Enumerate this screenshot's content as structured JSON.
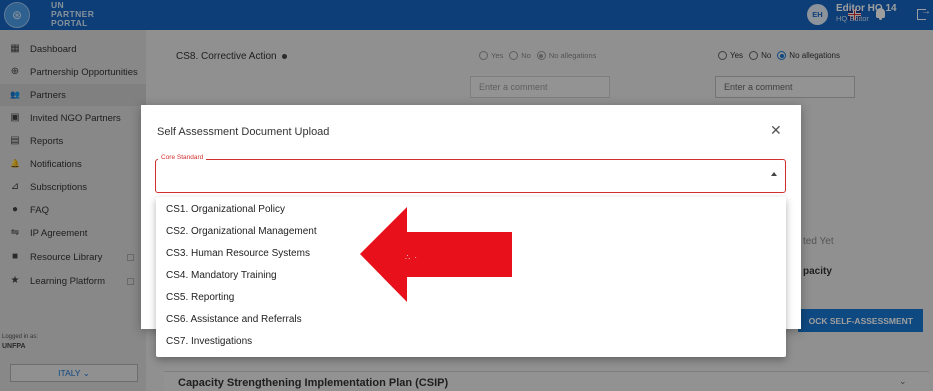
{
  "header": {
    "brand_lines": [
      "UN",
      "PARTNER",
      "PORTAL"
    ],
    "user_initials": "EH",
    "user_name": "Editor HQ 14",
    "user_role": "HQ Editor"
  },
  "sidebar": {
    "items": [
      {
        "label": "Dashboard",
        "icon": "dashboard-icon",
        "glyph": "▦"
      },
      {
        "label": "Partnership Opportunities",
        "icon": "globe-icon",
        "glyph": "⊕"
      },
      {
        "label": "Partners",
        "icon": "people-icon",
        "glyph": "👥",
        "active": true
      },
      {
        "label": "Invited NGO Partners",
        "icon": "contact-icon",
        "glyph": "▣"
      },
      {
        "label": "Reports",
        "icon": "report-icon",
        "glyph": "▤"
      },
      {
        "label": "Notifications",
        "icon": "bell-icon",
        "glyph": "🔔"
      },
      {
        "label": "Subscriptions",
        "icon": "rss-icon",
        "glyph": "⊿"
      },
      {
        "label": "FAQ",
        "icon": "help-icon",
        "glyph": "●"
      },
      {
        "label": "IP Agreement",
        "icon": "handshake-icon",
        "glyph": "⇋"
      },
      {
        "label": "Resource Library",
        "icon": "book-icon",
        "glyph": "■",
        "external": true
      },
      {
        "label": "Learning Platform",
        "icon": "star-icon",
        "glyph": "★",
        "external": true
      }
    ],
    "logged_in_label": "Logged in as:",
    "logged_in_org": "UNFPA",
    "country_button": "ITALY ⌄"
  },
  "background": {
    "row_title": "CS8. Corrective Action",
    "radio_options": [
      "Yes",
      "No",
      "No allegations"
    ],
    "comment_placeholder": "Enter a comment",
    "partial_status": "ted Yet",
    "partial_capacity": "pacity",
    "unlock_button": "OCK SELF-ASSESSMENT",
    "csip_title": "Capacity Strengthening Implementation Plan (CSIP)"
  },
  "modal": {
    "title": "Self Assessment Document Upload",
    "select_label": "Core Standard",
    "options": [
      "CS1. Organizational Policy",
      "CS2. Organizational Management",
      "CS3. Human Resource Systems",
      "CS4. Mandatory Training",
      "CS5. Reporting",
      "CS6. Assistance and Referrals",
      "CS7. Investigations"
    ]
  },
  "colors": {
    "header_bg": "#1565c0",
    "accent": "#1976d2",
    "error": "#d32f2f",
    "arrow": "#e8101a"
  }
}
